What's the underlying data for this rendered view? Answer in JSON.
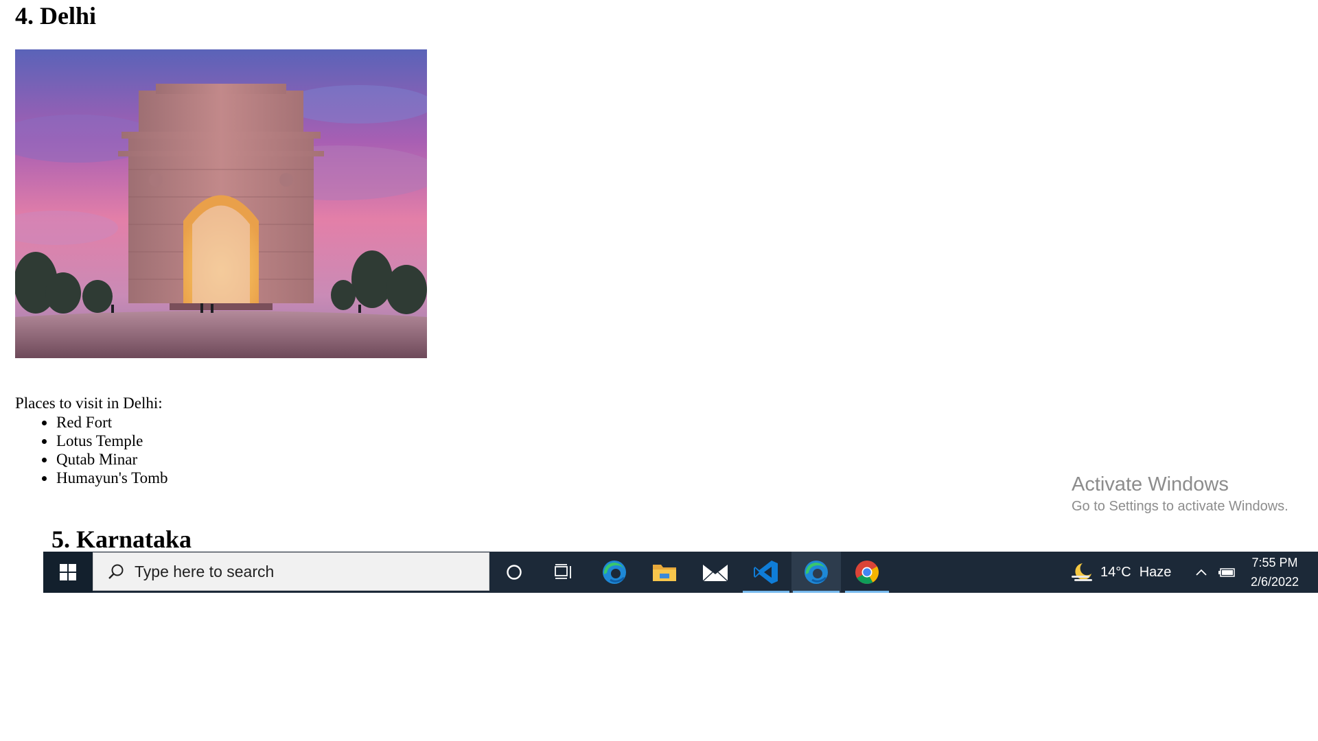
{
  "page": {
    "section4_heading": "4. Delhi",
    "section4_image_alt": "India Gate, Delhi",
    "intro": "Places to visit in Delhi:",
    "places": [
      "Red Fort",
      "Lotus Temple",
      "Qutab Minar",
      "Humayun's Tomb"
    ],
    "section5_heading": "5. Karnataka"
  },
  "watermark": {
    "title": "Activate Windows",
    "subtitle": "Go to Settings to activate Windows."
  },
  "taskbar": {
    "search_placeholder": "Type here to search",
    "apps": [
      "cortana-icon",
      "task-view-icon",
      "edge-icon",
      "file-explorer-icon",
      "mail-icon",
      "vscode-icon",
      "edge-icon",
      "chrome-icon"
    ],
    "weather_temp": "14°C",
    "weather_condition": "Haze",
    "time": "7:55 PM",
    "date": "2/6/2022"
  },
  "colors": {
    "taskbar_bg": "#1c2938",
    "active_underline": "#76b9ed",
    "watermark_text": "#8c8c8c"
  }
}
